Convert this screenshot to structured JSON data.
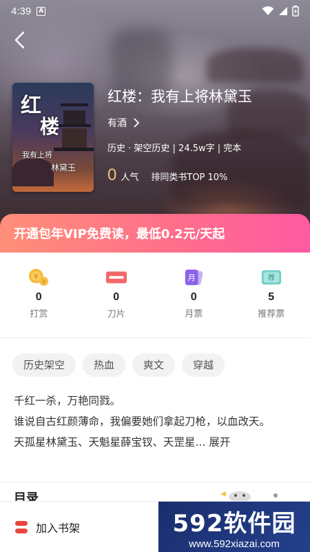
{
  "status_bar": {
    "time": "4:39",
    "notification_icon": "A"
  },
  "book": {
    "title": "红楼：我有上将林黛玉",
    "author": "有酒",
    "meta": "历史 · 架空历史 | 24.5w字 | 完本",
    "popularity_value": "0",
    "popularity_label": "人气",
    "rank": "排同类书TOP 10%",
    "cover": {
      "title_line1": "红",
      "title_line2": "楼",
      "subtitle_line1": "我有上将",
      "subtitle_line2": "林黛玉"
    }
  },
  "vip_banner": "开通包年VIP免费读，最低0.2元/天起",
  "stats": [
    {
      "icon": "coin-icon",
      "value": "0",
      "label": "打赏"
    },
    {
      "icon": "blade-icon",
      "value": "0",
      "label": "刀片"
    },
    {
      "icon": "monthly-ticket-icon",
      "value": "0",
      "label": "月票",
      "glyph": "月"
    },
    {
      "icon": "recommend-ticket-icon",
      "value": "5",
      "label": "推荐票",
      "glyph": "荐"
    }
  ],
  "tags": [
    "历史架空",
    "热血",
    "爽文",
    "穿越"
  ],
  "description": {
    "line1": "千红一杀，万艳同戮。",
    "line2": "谁说自古红颜薄命，我偏要她们拿起刀枪，以血改天。",
    "line3": "天孤星林黛玉、天魁星薛宝钗、天罡星...",
    "expand_label": "展开"
  },
  "next_section_title": "目录",
  "bottom_bar": {
    "add_to_shelf": "加入书架"
  },
  "watermark": {
    "logo": "592软件园",
    "url": "www.592xiazai.com"
  },
  "colors": {
    "vip_gradient_start": "#ff8f79",
    "vip_gradient_end": "#ff5aa2",
    "popularity": "#f2c27a",
    "shelf_icon": "#e8453c"
  }
}
